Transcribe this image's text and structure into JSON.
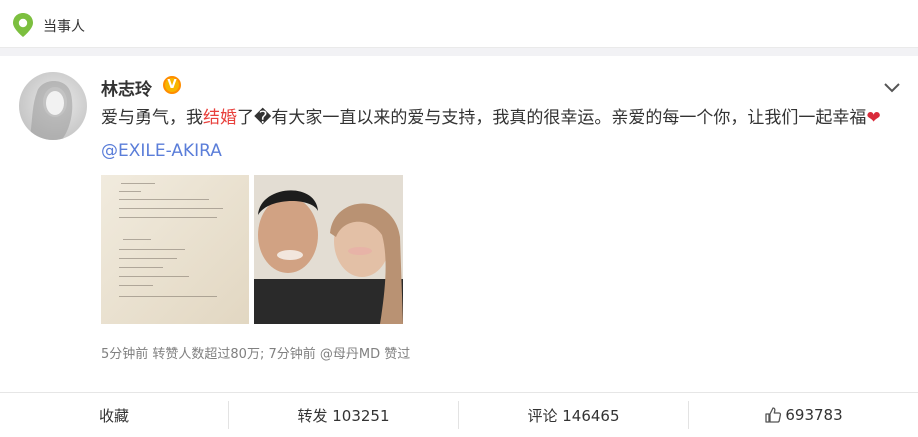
{
  "topbar": {
    "label": "当事人",
    "icon": "location-icon",
    "icon_color": "#7cbf3f"
  },
  "post": {
    "username": "林志玲",
    "verified_badge": "V",
    "text_part1": "爱与勇气，我",
    "text_highlight": "结婚",
    "text_part2": "了�有大家一直以来的爱与支持，我真的很幸运。亲爱的每一个你，让我们一起幸福",
    "heart": "❤",
    "mention": "@EXILE-AKIRA",
    "meta": "5分钟前 转赞人数超过80万; 7分钟前 @母丹MD 赞过",
    "highlight_color": "#e8403c",
    "mention_color": "#5b7ed9"
  },
  "actions": {
    "collect": "收藏",
    "repost": "转发 103251",
    "comment": "评论 146465",
    "like": "693783"
  }
}
